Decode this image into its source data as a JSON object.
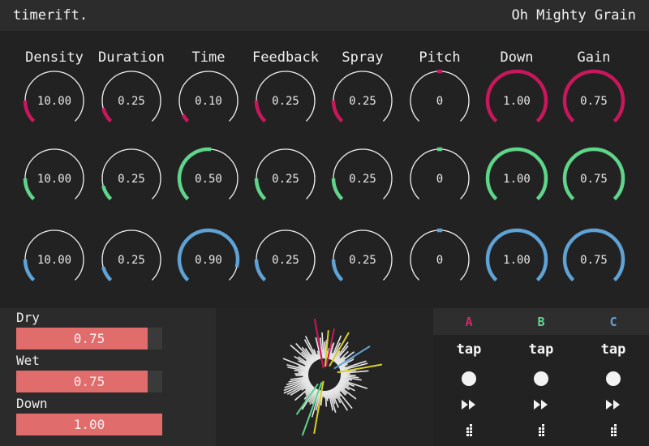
{
  "app": {
    "logo": "timerift.",
    "preset_name": "Oh Mighty Grain"
  },
  "colors": {
    "row1": "#c8175c",
    "row2": "#5fd58a",
    "row3": "#5fa3d6",
    "mix_fill": "#e06c6c"
  },
  "params": [
    "Density",
    "Duration",
    "Time",
    "Feedback",
    "Spray",
    "Pitch",
    "Down",
    "Gain"
  ],
  "rows": [
    {
      "color_key": "row1",
      "values": [
        "10.00",
        "0.25",
        "0.10",
        "0.25",
        "0.25",
        "0",
        "1.00",
        "0.75"
      ],
      "arc_start_deg": [
        -90,
        -105,
        -120,
        -90,
        -90,
        -5,
        -135,
        -135
      ],
      "arc_end_deg": [
        -135,
        -135,
        -135,
        -135,
        -135,
        5,
        135,
        135
      ]
    },
    {
      "color_key": "row2",
      "values": [
        "10.00",
        "0.25",
        "0.50",
        "0.25",
        "0.25",
        "0",
        "1.00",
        "0.75"
      ],
      "arc_start_deg": [
        -90,
        -105,
        -135,
        -90,
        -90,
        -5,
        -135,
        -135
      ],
      "arc_end_deg": [
        -135,
        -135,
        5,
        -135,
        -135,
        5,
        135,
        135
      ]
    },
    {
      "color_key": "row3",
      "values": [
        "10.00",
        "0.25",
        "0.90",
        "0.25",
        "0.25",
        "0",
        "1.00",
        "0.75"
      ],
      "arc_start_deg": [
        -90,
        -105,
        -135,
        -90,
        -90,
        -5,
        -135,
        -135
      ],
      "arc_end_deg": [
        -135,
        -135,
        105,
        -135,
        -135,
        5,
        135,
        135
      ]
    }
  ],
  "mix": [
    {
      "label": "Dry",
      "value": "0.75",
      "fraction": 0.9
    },
    {
      "label": "Wet",
      "value": "0.75",
      "fraction": 0.9
    },
    {
      "label": "Down",
      "value": "1.00",
      "fraction": 1.0
    }
  ],
  "taps": [
    {
      "name": "A",
      "color": "#d8266e",
      "label": "tap"
    },
    {
      "name": "B",
      "color": "#5fd58a",
      "label": "tap"
    },
    {
      "name": "C",
      "color": "#5fa3d6",
      "label": "tap"
    }
  ],
  "icons": {
    "record": "record-icon",
    "forward": "fast-forward-icon",
    "grid": "dot-grid-icon"
  }
}
